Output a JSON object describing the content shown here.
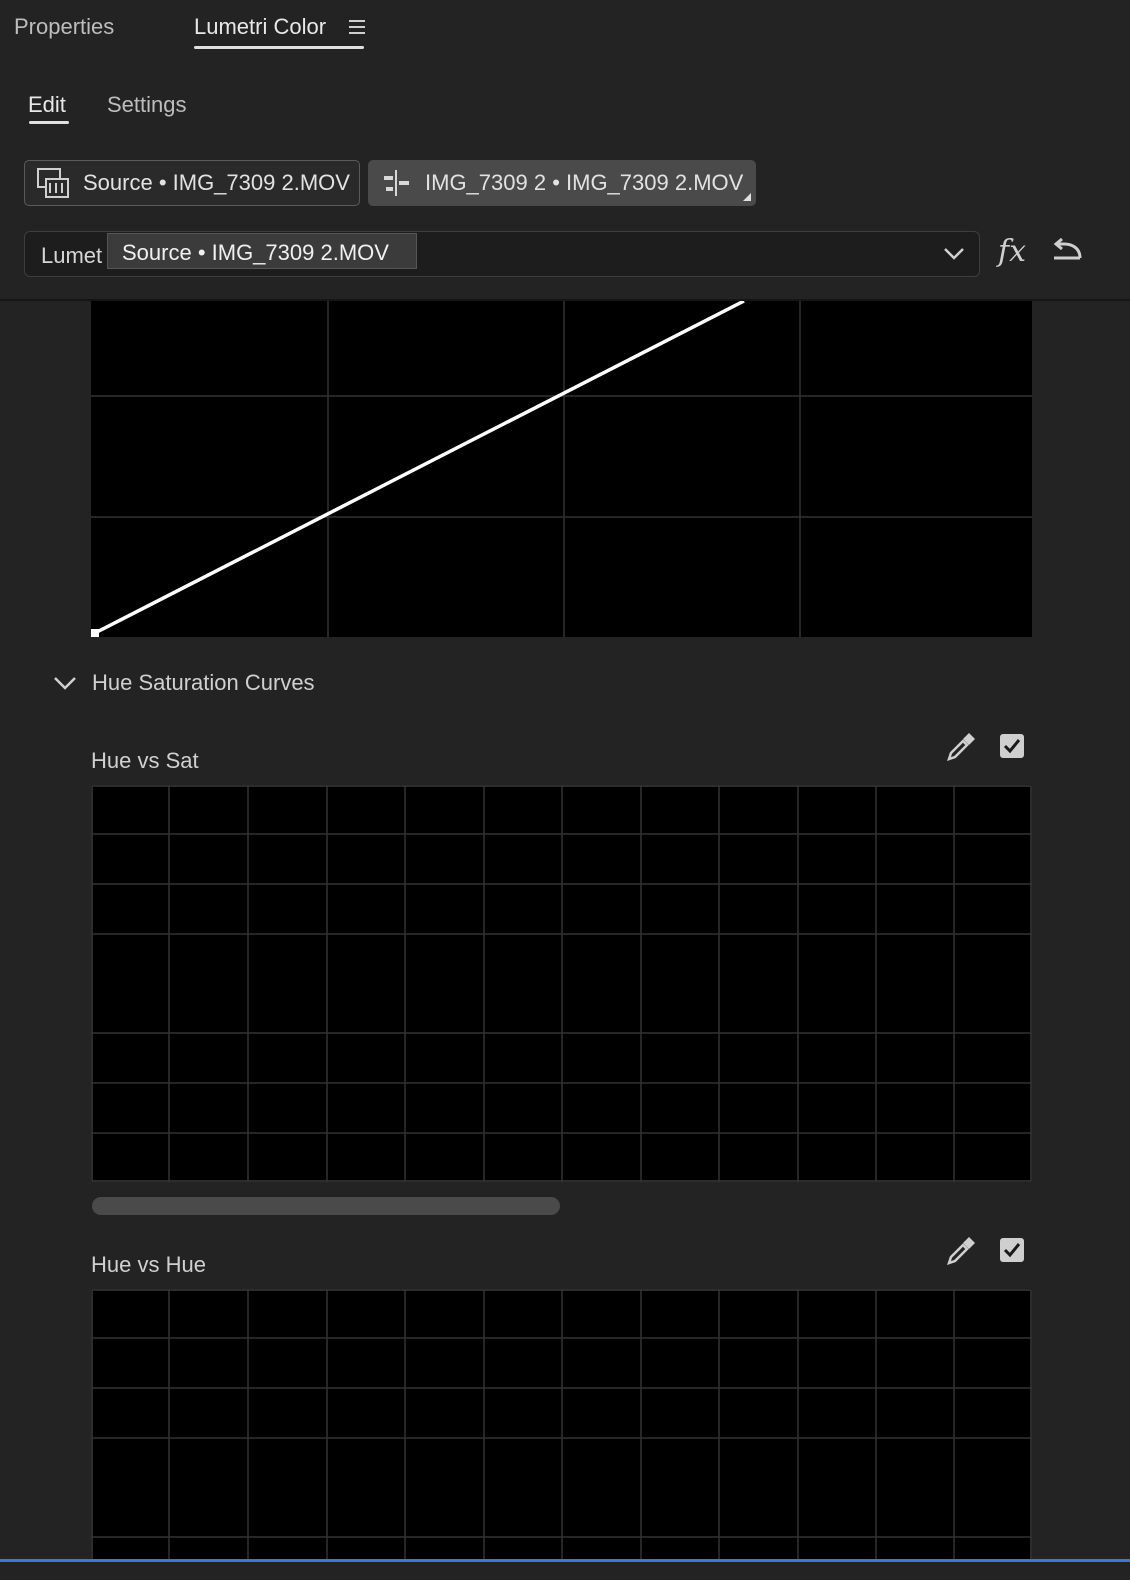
{
  "panel_tabs": [
    {
      "label": "Properties",
      "active": false
    },
    {
      "label": "Lumetri Color",
      "active": true
    }
  ],
  "sub_tabs": [
    {
      "label": "Edit",
      "active": true
    },
    {
      "label": "Settings",
      "active": false
    }
  ],
  "clip_buttons": {
    "source": {
      "label": "Source • IMG_7309 2.MOV",
      "icon": "film-clip-icon"
    },
    "sequence": {
      "label": "IMG_7309 2 • IMG_7309 2.MOV",
      "icon": "sequence-icon"
    }
  },
  "effect_dropdown": {
    "value": "Lumetri Color",
    "visible_text": "Lumet",
    "tooltip": "Source • IMG_7309 2.MOV"
  },
  "icons": {
    "fx": "fx-icon",
    "reset": "reset-icon",
    "chevron": "chevron-down-icon",
    "eyedropper": "eyedropper-icon",
    "checkbox": "checkbox-checked-icon"
  },
  "sections": {
    "hue_saturation_curves": {
      "title": "Hue Saturation Curves",
      "expanded": true,
      "curves": [
        {
          "label": "Hue vs Sat",
          "enabled": true
        },
        {
          "label": "Hue vs Hue",
          "enabled": true
        }
      ]
    }
  },
  "colors": {
    "background": "#232323",
    "graph": "#000000",
    "grid": "#333333",
    "hue_gradient": [
      "#40e0e0",
      "#1030c0",
      "#8020e0",
      "#e020d0",
      "#e02020",
      "#f09020",
      "#e0e030",
      "#40d030",
      "#40e0e0"
    ],
    "accent_blue": "#3b78d8"
  }
}
